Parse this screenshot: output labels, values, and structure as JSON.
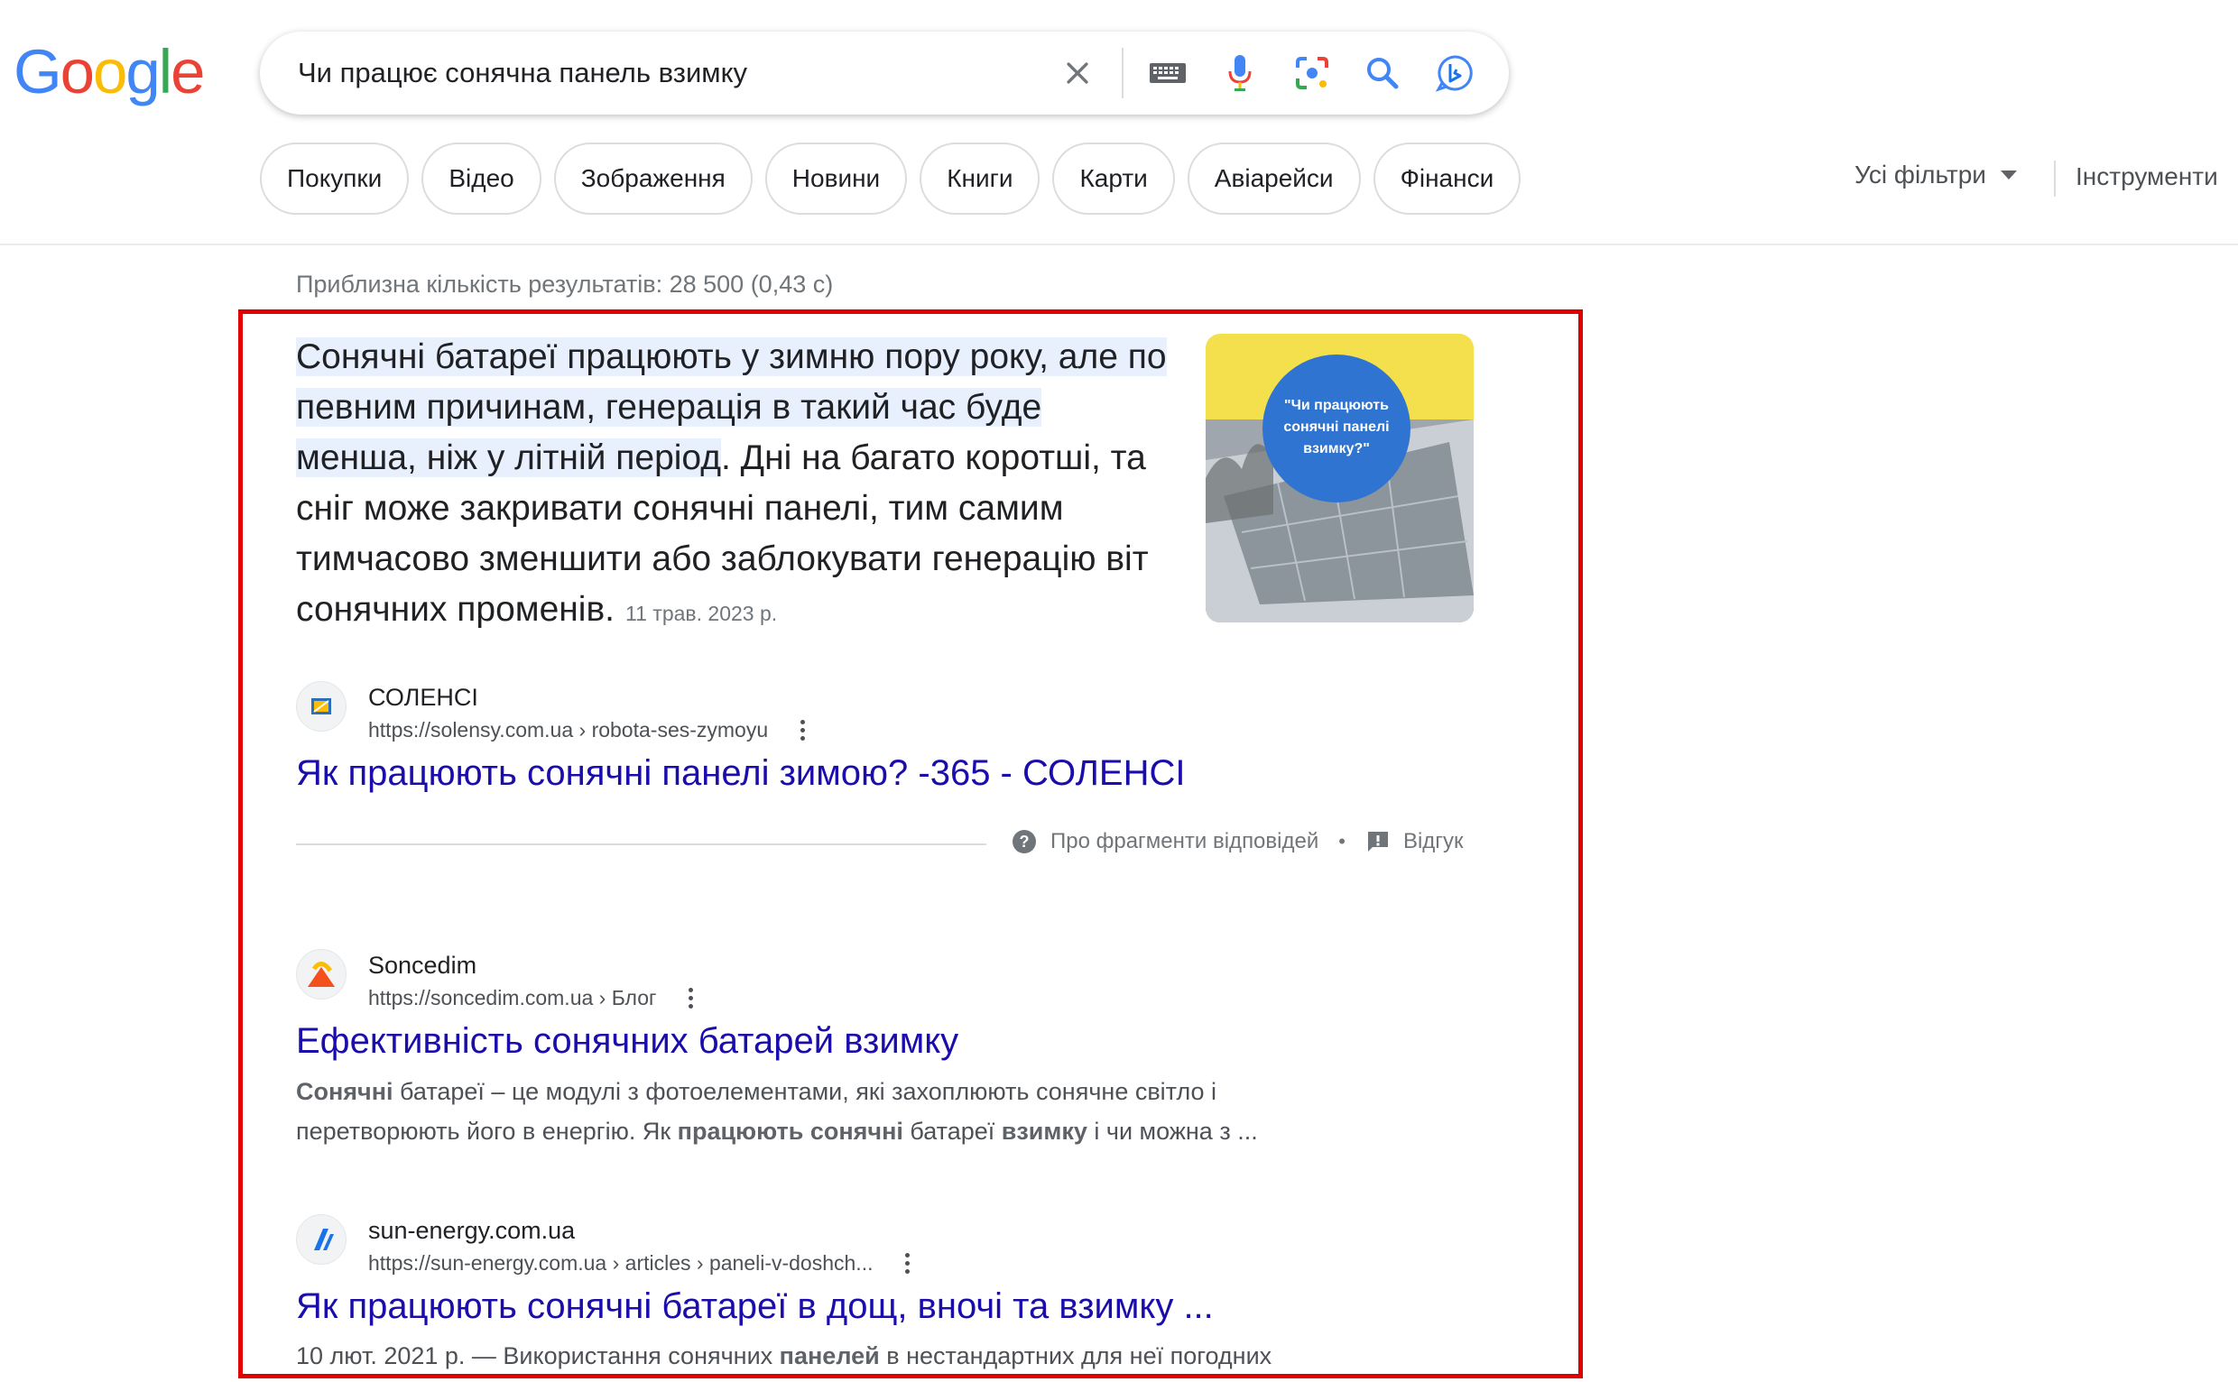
{
  "logo": {
    "letters": [
      "G",
      "o",
      "o",
      "g",
      "l",
      "e"
    ],
    "colors": [
      "#4285f4",
      "#ea4335",
      "#fbbc05",
      "#4285f4",
      "#34a853",
      "#ea4335"
    ]
  },
  "search": {
    "query": "Чи працює сонячна панель взимку"
  },
  "filters": {
    "chips": [
      "Покупки",
      "Відео",
      "Зображення",
      "Новини",
      "Книги",
      "Карти",
      "Авіарейси",
      "Фінанси"
    ],
    "all_filters": "Усі фільтри",
    "tools": "Інструменти"
  },
  "stats": "Приблизна кількість результатів: 28 500 (0,43 с)",
  "snippet": {
    "text_highlighted": "Сонячні батареї працюють у зимню пору року, але по певним причинам, генерація в такий час буде менша, ніж у літній період",
    "text_rest": ". Дні на багато коротші, та сніг може закривати сонячні панелі, тим самим тимчасово зменшити або заблокувати генерацію віт сонячних променів.",
    "date": "11 трав. 2023 р.",
    "image_caption": "\"Чи працюють сонячні панелі взимку?\"",
    "source_name": "СОЛЕНСІ",
    "source_url": "https://solensy.com.ua › robota-ses-zymoyu",
    "title": "Як працюють сонячні панелі зимою? -365 - СОЛЕНСІ",
    "about": "Про фрагменти відповідей",
    "feedback": "Відгук"
  },
  "results": [
    {
      "site": "Soncedim",
      "url": "https://soncedim.com.ua › Блог",
      "title": "Ефективність сонячних батарей взимку",
      "desc": [
        {
          "b": "Сонячні"
        },
        {
          "t": " батареї – це модулі з фотоелементами, які захоплюють сонячне світло і перетворюють його в енергію. Як "
        },
        {
          "b": "працюють сонячні"
        },
        {
          "t": " батареї "
        },
        {
          "b": "взимку"
        },
        {
          "t": " і чи можна з ..."
        }
      ]
    },
    {
      "site": "sun-energy.com.ua",
      "url": "https://sun-energy.com.ua › articles › paneli-v-doshch...",
      "title": "Як працюють сонячні батареї в дощ, вночі та взимку ...",
      "desc": [
        {
          "t": "10 лют. 2021 р. — Використання сонячних "
        },
        {
          "b": "панелей"
        },
        {
          "t": " в нестандартних для неї погодних"
        }
      ]
    }
  ]
}
